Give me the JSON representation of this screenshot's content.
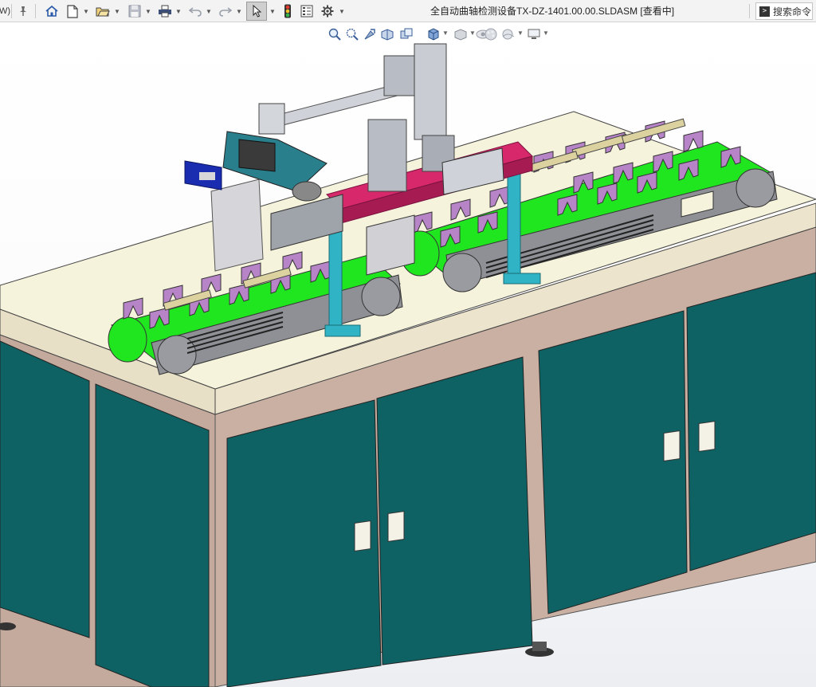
{
  "window": {
    "title": "全自动曲轴检测设备TX-DZ-1401.00.00.SLDASM [查看中]",
    "left_fragment": "W)"
  },
  "toolbar": {
    "items": [
      {
        "icon": "pin-icon"
      },
      {
        "icon": "home-icon"
      },
      {
        "icon": "new-document-icon"
      },
      {
        "icon": "open-folder-icon"
      },
      {
        "icon": "save-icon"
      },
      {
        "icon": "print-icon"
      },
      {
        "icon": "undo-icon"
      },
      {
        "icon": "redo-icon"
      },
      {
        "icon": "select-cursor-icon"
      },
      {
        "icon": "traffic-light-icon"
      },
      {
        "icon": "file-properties-icon"
      },
      {
        "icon": "options-gear-icon"
      }
    ]
  },
  "search": {
    "label": "搜索命令",
    "icon": "command-prompt-icon"
  },
  "heads_up_toolbar": {
    "items": [
      {
        "icon": "zoom-to-fit-icon"
      },
      {
        "icon": "zoom-to-area-icon"
      },
      {
        "icon": "previous-view-icon"
      },
      {
        "icon": "section-view-icon"
      },
      {
        "icon": "dynamic-annotation-icon"
      },
      {
        "icon": "view-orientation-icon"
      },
      {
        "icon": "display-style-icon"
      },
      {
        "icon": "hide-show-items-icon"
      },
      {
        "icon": "edit-appearance-icon"
      },
      {
        "icon": "apply-scene-icon"
      },
      {
        "icon": "view-settings-icon"
      }
    ]
  },
  "model": {
    "colors": {
      "cabinet": "#0f6264",
      "cabinet_dark": "#0a4d4f",
      "frame": "#c2a89a",
      "tabletop": "#f6f3dc",
      "conveyor_belt": "#20e620",
      "fixture": "#b884c8",
      "gantry": "#2fb3c5",
      "beam": "#d6286a",
      "metal": "#b8bcc4",
      "camera": "#1a2db0"
    }
  }
}
